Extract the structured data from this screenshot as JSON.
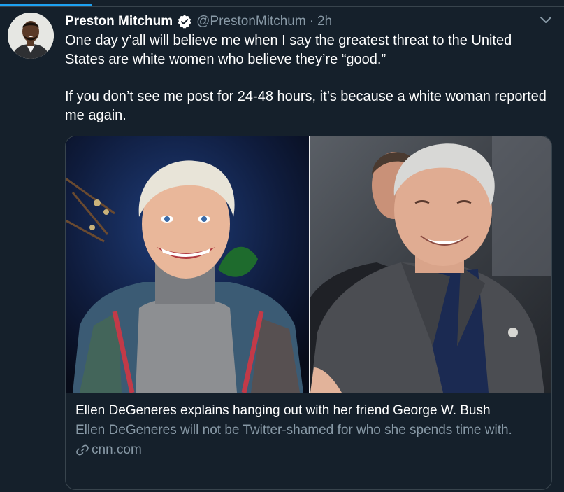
{
  "tweet": {
    "display_name": "Preston Mitchum",
    "handle": "@PrestonMitchum",
    "separator": "·",
    "time": "2h",
    "paragraphs": [
      "One day y’all will believe me when I say the greatest threat to the United States are white women who believe they’re “good.”",
      "If you don’t see me post for 24-48 hours, it’s because a white woman reported me again."
    ]
  },
  "card": {
    "title": "Ellen DeGeneres explains hanging out with her friend George W. Bush",
    "description": "Ellen DeGeneres will not be Twitter-shamed for who she spends time with.",
    "domain": "cnn.com"
  },
  "colors": {
    "background": "#15202b",
    "border": "#38444d",
    "muted_text": "#8899a6",
    "accent": "#1da1f2"
  },
  "icons": {
    "verified": "verified-badge-icon",
    "more": "chevron-down-icon",
    "link": "link-icon"
  }
}
